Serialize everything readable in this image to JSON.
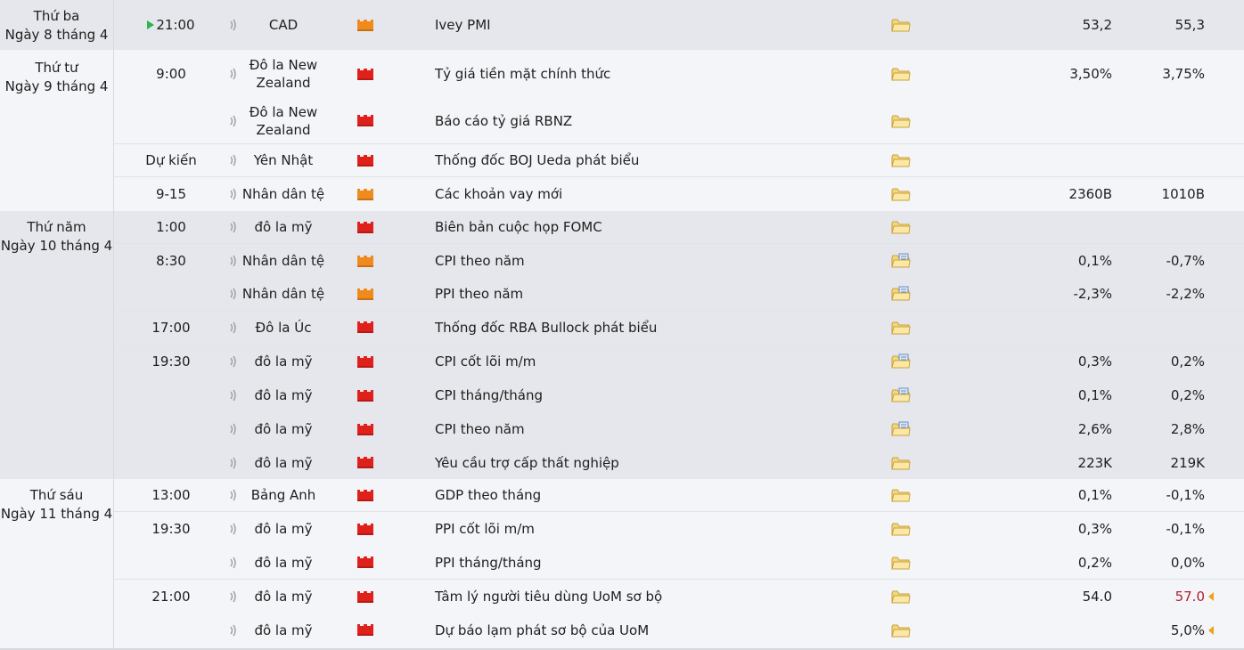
{
  "colors": {
    "impact_high": "#e0201b",
    "impact_medium": "#f08a1c",
    "accent_red": "#b0202a",
    "warn": "#f0a21a",
    "live": "#2bb64d"
  },
  "days": [
    {
      "weekday": "Thứ ba",
      "date": "Ngày 8 tháng 4"
    },
    {
      "weekday": "Thứ tư",
      "date": "Ngày 9 tháng 4"
    },
    {
      "weekday": "Thứ năm",
      "date": "Ngày 10 tháng 4"
    },
    {
      "weekday": "Thứ sáu",
      "date": "Ngày 11 tháng 4"
    }
  ],
  "events": [
    {
      "time": "21:00",
      "live": true,
      "currency": "CAD",
      "impact": "medium",
      "event": "Ivey PMI",
      "icon": "folder-icon",
      "actual": "53,2",
      "forecast": "55,3",
      "forecast_alert": false
    },
    {
      "time": "9:00",
      "live": false,
      "currency": "Đô la New Zealand",
      "impact": "high",
      "event": "Tỷ giá tiền mặt chính thức",
      "icon": "folder-icon",
      "actual": "3,50%",
      "forecast": "3,75%",
      "forecast_alert": false
    },
    {
      "time": "",
      "live": false,
      "currency": "Đô la New Zealand",
      "impact": "high",
      "event": "Báo cáo tỷ giá RBNZ",
      "icon": "folder-icon",
      "actual": "",
      "forecast": "",
      "forecast_alert": false
    },
    {
      "time": "Dự kiến",
      "live": false,
      "currency": "Yên Nhật",
      "impact": "high",
      "event": "Thống đốc BOJ Ueda phát biểu",
      "icon": "folder-icon",
      "actual": "",
      "forecast": "",
      "forecast_alert": false
    },
    {
      "time": "9-15",
      "live": false,
      "currency": "Nhân dân tệ",
      "impact": "medium",
      "event": "Các khoản vay mới",
      "icon": "folder-icon",
      "actual": "2360B",
      "forecast": "1010B",
      "forecast_alert": false
    },
    {
      "time": "1:00",
      "live": false,
      "currency": "đô la mỹ",
      "impact": "high",
      "event": "Biên bản cuộc họp FOMC",
      "icon": "folder-icon",
      "actual": "",
      "forecast": "",
      "forecast_alert": false
    },
    {
      "time": "8:30",
      "live": false,
      "currency": "Nhân dân tệ",
      "impact": "medium",
      "event": "CPI theo năm",
      "icon": "folder-document-icon",
      "actual": "0,1%",
      "forecast": "-0,7%",
      "forecast_alert": false
    },
    {
      "time": "",
      "live": false,
      "currency": "Nhân dân tệ",
      "impact": "medium",
      "event": "PPI theo năm",
      "icon": "folder-document-icon",
      "actual": "-2,3%",
      "forecast": "-2,2%",
      "forecast_alert": false
    },
    {
      "time": "17:00",
      "live": false,
      "currency": "Đô la Úc",
      "impact": "high",
      "event": "Thống đốc RBA Bullock phát biểu",
      "icon": "folder-icon",
      "actual": "",
      "forecast": "",
      "forecast_alert": false
    },
    {
      "time": "19:30",
      "live": false,
      "currency": "đô la mỹ",
      "impact": "high",
      "event": "CPI cốt lõi m/m",
      "icon": "folder-document-icon",
      "actual": "0,3%",
      "forecast": "0,2%",
      "forecast_alert": false
    },
    {
      "time": "",
      "live": false,
      "currency": "đô la mỹ",
      "impact": "high",
      "event": "CPI tháng/tháng",
      "icon": "folder-document-icon",
      "actual": "0,1%",
      "forecast": "0,2%",
      "forecast_alert": false
    },
    {
      "time": "",
      "live": false,
      "currency": "đô la mỹ",
      "impact": "high",
      "event": "CPI theo năm",
      "icon": "folder-document-icon",
      "actual": "2,6%",
      "forecast": "2,8%",
      "forecast_alert": false
    },
    {
      "time": "",
      "live": false,
      "currency": "đô la mỹ",
      "impact": "high",
      "event": "Yêu cầu trợ cấp thất nghiệp",
      "icon": "folder-icon",
      "actual": "223K",
      "forecast": "219K",
      "forecast_alert": false
    },
    {
      "time": "13:00",
      "live": false,
      "currency": "Bảng Anh",
      "impact": "high",
      "event": "GDP theo tháng",
      "icon": "folder-icon",
      "actual": "0,1%",
      "forecast": "-0,1%",
      "forecast_alert": false
    },
    {
      "time": "19:30",
      "live": false,
      "currency": "đô la mỹ",
      "impact": "high",
      "event": "PPI cốt lõi m/m",
      "icon": "folder-icon",
      "actual": "0,3%",
      "forecast": "-0,1%",
      "forecast_alert": false
    },
    {
      "time": "",
      "live": false,
      "currency": "đô la mỹ",
      "impact": "high",
      "event": "PPI tháng/tháng",
      "icon": "folder-icon",
      "actual": "0,2%",
      "forecast": "0,0%",
      "forecast_alert": false
    },
    {
      "time": "21:00",
      "live": false,
      "currency": "đô la mỹ",
      "impact": "high",
      "event": "Tâm lý người tiêu dùng UoM sơ bộ",
      "icon": "folder-icon",
      "actual": "54.0",
      "forecast": "57.0",
      "forecast_alert": true
    },
    {
      "time": "",
      "live": false,
      "currency": "đô la mỹ",
      "impact": "high",
      "event": "Dự báo lạm phát sơ bộ của UoM",
      "icon": "folder-icon",
      "actual": "",
      "forecast": "5,0%",
      "forecast_alert": true
    }
  ]
}
